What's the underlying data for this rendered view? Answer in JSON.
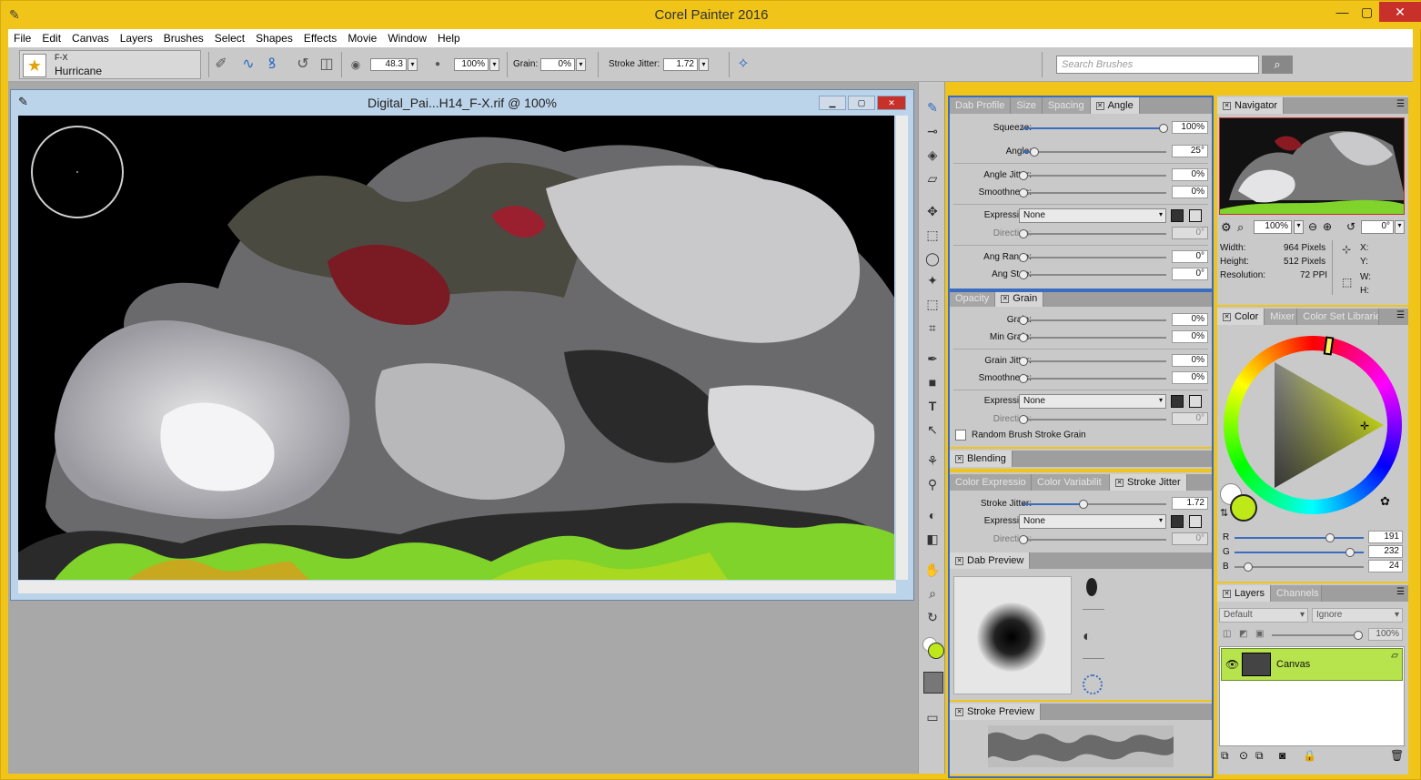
{
  "app": {
    "title": "Corel Painter 2016",
    "window_buttons": {
      "minimize": "—",
      "maximize": "▢",
      "close": "✕"
    }
  },
  "menu": [
    "File",
    "Edit",
    "Canvas",
    "Layers",
    "Brushes",
    "Select",
    "Shapes",
    "Effects",
    "Movie",
    "Window",
    "Help"
  ],
  "property_bar": {
    "brush_category": "F-X",
    "brush_variant": "Hurricane",
    "size_value": "48.3",
    "opacity_value": "100%",
    "grain_label": "Grain:",
    "grain_value": "0%",
    "stroke_jitter_label": "Stroke Jitter:",
    "stroke_jitter_value": "1.72",
    "search_placeholder": "Search Brushes"
  },
  "document": {
    "title": "Digital_Pai...H14_F-X.rif @ 100%"
  },
  "angle_panel": {
    "tabs": [
      "Dab Profile",
      "Size",
      "Spacing",
      "Angle"
    ],
    "squeeze_label": "Squeeze:",
    "squeeze_value": "100%",
    "angle_label": "Angle:",
    "angle_value": "25°",
    "angle_jitter_label": "Angle Jitter:",
    "angle_jitter_value": "0%",
    "smoothness_label": "Smoothness:",
    "smoothness_value": "0%",
    "expression_label": "Expression:",
    "expression_value": "None",
    "direction_label": "Direction:",
    "direction_value": "0°",
    "ang_range_label": "Ang Range:",
    "ang_range_value": "0°",
    "ang_step_label": "Ang Step:",
    "ang_step_value": "0°"
  },
  "grain_panel": {
    "tabs": [
      "Opacity",
      "Grain"
    ],
    "grain_label": "Grain:",
    "grain_value": "0%",
    "min_grain_label": "Min Grain:",
    "min_grain_value": "0%",
    "grain_jitter_label": "Grain Jitter:",
    "grain_jitter_value": "0%",
    "smoothness_label": "Smoothness:",
    "smoothness_value": "0%",
    "expression_label": "Expression:",
    "expression_value": "None",
    "direction_label": "Direction:",
    "direction_value": "0°",
    "random_label": "Random Brush Stroke Grain"
  },
  "blending_panel": {
    "tab": "Blending"
  },
  "jitter_panel": {
    "tabs": [
      "Color Expressio",
      "Color Variabilit",
      "Stroke Jitter"
    ],
    "stroke_jitter_label": "Stroke Jitter:",
    "stroke_jitter_value": "1.72",
    "expression_label": "Expression:",
    "expression_value": "None",
    "direction_label": "Direction:",
    "direction_value": "0°"
  },
  "dab_preview": {
    "tab": "Dab Preview"
  },
  "stroke_preview": {
    "tab": "Stroke Preview"
  },
  "navigator": {
    "tab": "Navigator",
    "zoom": "100%",
    "rotation": "0°",
    "width_label": "Width:",
    "width_value": "964 Pixels",
    "height_label": "Height:",
    "height_value": "512 Pixels",
    "resolution_label": "Resolution:",
    "resolution_value": "72 PPI",
    "x_label": "X:",
    "y_label": "Y:",
    "w_label": "W:",
    "h_label": "H:"
  },
  "color_panel": {
    "tabs": [
      "Color",
      "Mixer",
      "Color Set Librarie"
    ],
    "r_label": "R",
    "r_value": "191",
    "g_label": "G",
    "g_value": "232",
    "b_label": "B",
    "b_value": "24",
    "main_color": "#bfe818"
  },
  "layers_panel": {
    "tabs": [
      "Layers",
      "Channels"
    ],
    "composite_method": "Default",
    "composite_depth": "Ignore",
    "opacity": "100%",
    "layer_name": "Canvas"
  }
}
